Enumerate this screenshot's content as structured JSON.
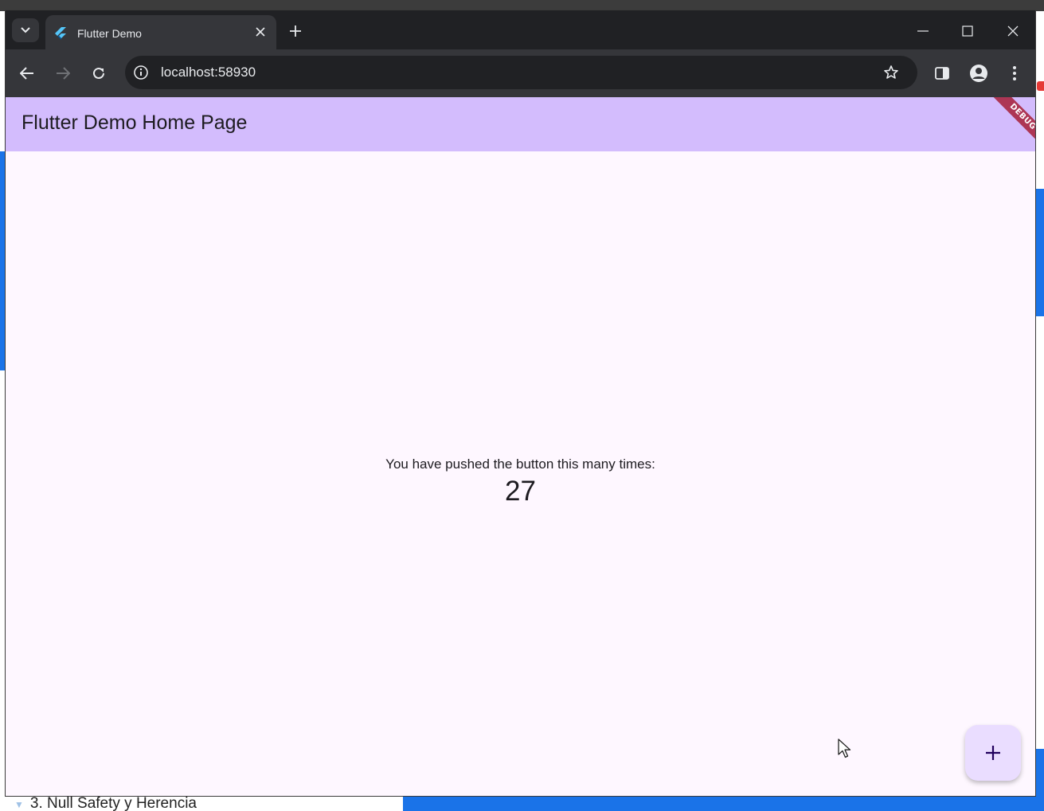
{
  "browser": {
    "tab_title": "Flutter Demo",
    "url": "localhost:58930"
  },
  "app": {
    "appbar_title": "Flutter Demo Home Page",
    "debug_banner": "DEBUG",
    "message": "You have pushed the button this many times:",
    "counter": "27",
    "fab_icon": "add-icon"
  },
  "background": {
    "bottom_text": "3. Null Safety y Herencia"
  },
  "colors": {
    "appbar": "#d3bcfd",
    "surface": "#fef7ff",
    "fab": "#eaddff",
    "debug": "#a61e37"
  }
}
